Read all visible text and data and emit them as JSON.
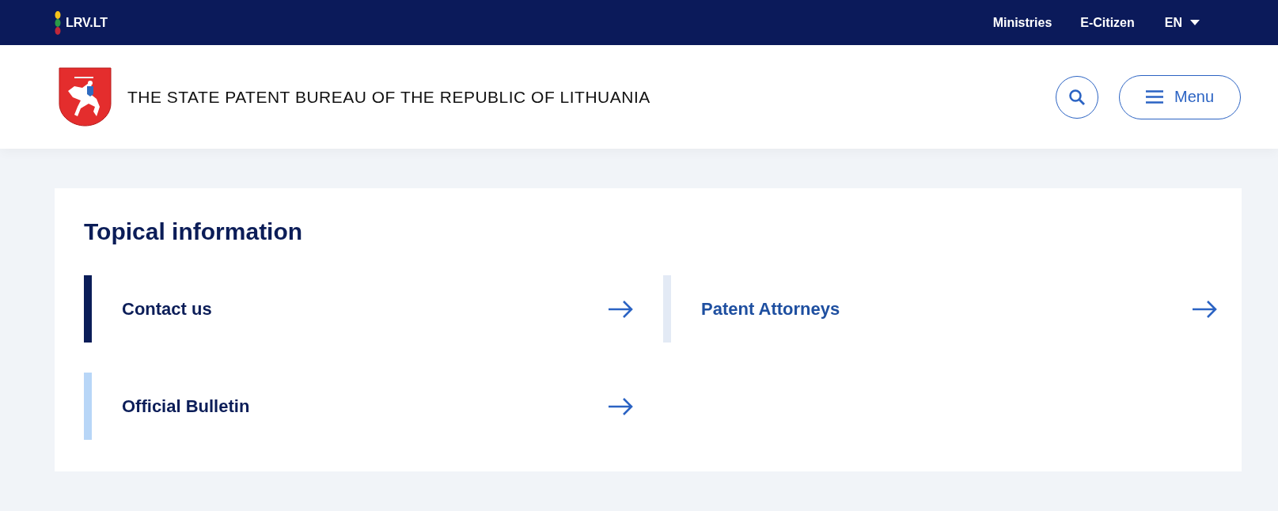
{
  "top_bar": {
    "logo": "LRV.LT",
    "links": [
      "Ministries",
      "E-Citizen"
    ],
    "language": "EN"
  },
  "header": {
    "title": "THE STATE PATENT BUREAU OF THE REPUBLIC OF LITHUANIA",
    "menu_button": "Menu"
  },
  "section": {
    "title": "Topical information",
    "items": [
      {
        "label": "Contact us",
        "color": "#0b1d58",
        "hovered": false
      },
      {
        "label": "Patent Attorneys",
        "color": "#e3eaf5",
        "hovered": true
      },
      {
        "label": "Official Bulletin",
        "color": "#b8d6f7",
        "hovered": false
      }
    ]
  }
}
